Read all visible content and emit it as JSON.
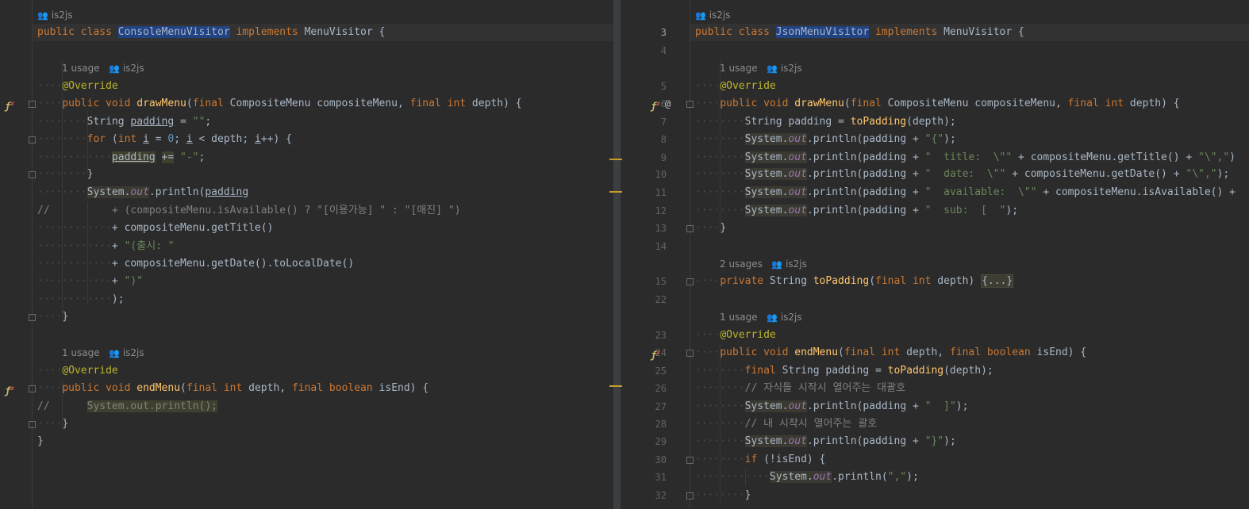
{
  "left_pane": {
    "author_hint": "is2js",
    "usage_hint_draw": "1 usage",
    "usage_hint_end": "1 usage",
    "class_name": "ConsoleMenuVisitor",
    "iface": "MenuVisitor"
  },
  "right_pane": {
    "author_hint": "is2js",
    "usage_hint_draw": "1 usage",
    "usage_hint_pad": "2 usages",
    "usage_hint_end": "1 usage",
    "class_name": "JsonMenuVisitor",
    "iface": "MenuVisitor",
    "line_numbers": [
      "3",
      "4",
      "5",
      "6",
      "7",
      "8",
      "9",
      "10",
      "11",
      "12",
      "13",
      "14",
      "15",
      "22",
      "23",
      "24",
      "25",
      "26",
      "27",
      "28",
      "29",
      "30",
      "31",
      "32"
    ],
    "fold_placeholder": "{...}"
  },
  "text": {
    "kw_public": "public",
    "kw_class": "class",
    "kw_implements": "implements",
    "kw_void": "void",
    "kw_final": "final",
    "kw_int": "int",
    "kw_for": "for",
    "kw_boolean": "boolean",
    "kw_private": "private",
    "kw_if": "if",
    "ann_override": "@Override",
    "fn_drawMenu": "drawMenu",
    "fn_endMenu": "endMenu",
    "fn_toPadding": "toPadding",
    "sys": "System",
    "out": "out",
    "println": ".println(",
    "cmt_korean_1": "// 자식들 시작시 열어주는 대괄호",
    "cmt_korean_2": "// 내 시작시 열어주는 괄호",
    "cmt_left_1": "+ (compositeMenu.isAvailable() ? \"[이용가능] \" : \"[매진] \")",
    "str_out_1": "\"(출시: \"",
    "str_close_paren": "\")\"",
    "str_brace_open": "\"{\"",
    "str_title": "\"  title:  \\\"\"",
    "str_date": "\"  date:  \\\"\"",
    "str_available": "\"  available:  \\\"\"",
    "str_sub": "\"  sub:  [  \"",
    "str_quote_comma": "\"\\\",\"",
    "str_bracket_close": "\"  ]\"",
    "str_brace_close": "\"}\"",
    "str_comma": "\",\"",
    "str_dash": "\"-\"",
    "str_empty": "\"\"",
    "num_zero": "0",
    "t_brace_open": " {",
    "t_brace_close": "}",
    "t_sp": " ",
    "t_composite_sig": "(final CompositeMenu compositeMenu, final int depth) {",
    "left_sysout_end": "System.out.println();"
  }
}
